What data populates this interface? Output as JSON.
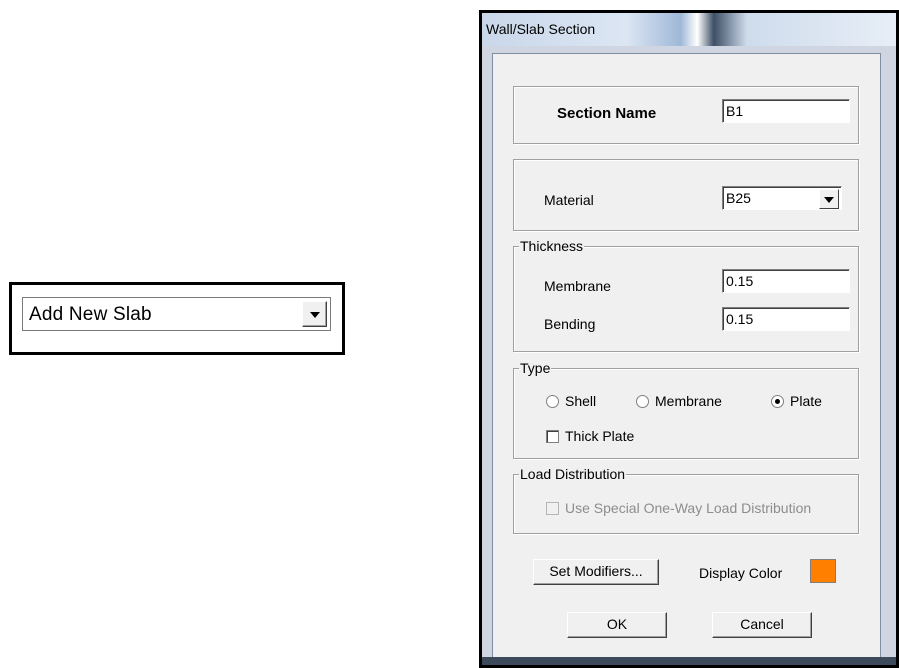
{
  "combo": {
    "text": "Add New Slab"
  },
  "dialog": {
    "title": "Wall/Slab Section",
    "section_name": {
      "label": "Section Name",
      "value": "B1"
    },
    "material": {
      "label": "Material",
      "value": "B25"
    },
    "thickness": {
      "legend": "Thickness",
      "membrane": {
        "label": "Membrane",
        "value": "0.15"
      },
      "bending": {
        "label": "Bending",
        "value": "0.15"
      }
    },
    "type": {
      "legend": "Type",
      "options": [
        {
          "label": "Shell",
          "selected": false
        },
        {
          "label": "Membrane",
          "selected": false
        },
        {
          "label": "Plate",
          "selected": true
        }
      ],
      "thick_plate": {
        "label": "Thick Plate",
        "checked": false
      }
    },
    "load_distribution": {
      "legend": "Load Distribution",
      "option": {
        "label": "Use Special One-Way Load Distribution",
        "checked": false,
        "enabled": false
      }
    },
    "set_modifiers_label": "Set Modifiers...",
    "display_color": {
      "label": "Display Color",
      "color": "#ff8000"
    },
    "ok_label": "OK",
    "cancel_label": "Cancel"
  },
  "colors": {
    "accent_swatch": "#ff8000",
    "dialog_bg": "#f0f0f0"
  }
}
